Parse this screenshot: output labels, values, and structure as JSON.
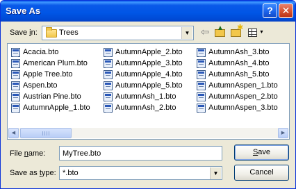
{
  "window": {
    "title": "Save As",
    "help_button": "?",
    "close_button": "✕"
  },
  "toolbar": {
    "save_in_label": "Save in:",
    "save_in_value": "Trees"
  },
  "files": [
    "Acacia.bto",
    "American Plum.bto",
    "Apple Tree.bto",
    "Aspen.bto",
    "Austrian Pine.bto",
    "AutumnApple_1.bto",
    "AutumnApple_2.bto",
    "AutumnApple_3.bto",
    "AutumnApple_4.bto",
    "AutumnApple_5.bto",
    "AutumnAsh_1.bto",
    "AutumnAsh_2.bto",
    "AutumnAsh_3.bto",
    "AutumnAsh_4.bto",
    "AutumnAsh_5.bto",
    "AutumnAspen_1.bto",
    "AutumnAspen_2.bto",
    "AutumnAspen_3.bto"
  ],
  "form": {
    "file_name_label": "File name:",
    "file_name_value": "MyTree.bto",
    "save_as_type_label": "Save as type:",
    "save_as_type_value": "*.bto"
  },
  "buttons": {
    "save": "Save",
    "cancel": "Cancel"
  }
}
